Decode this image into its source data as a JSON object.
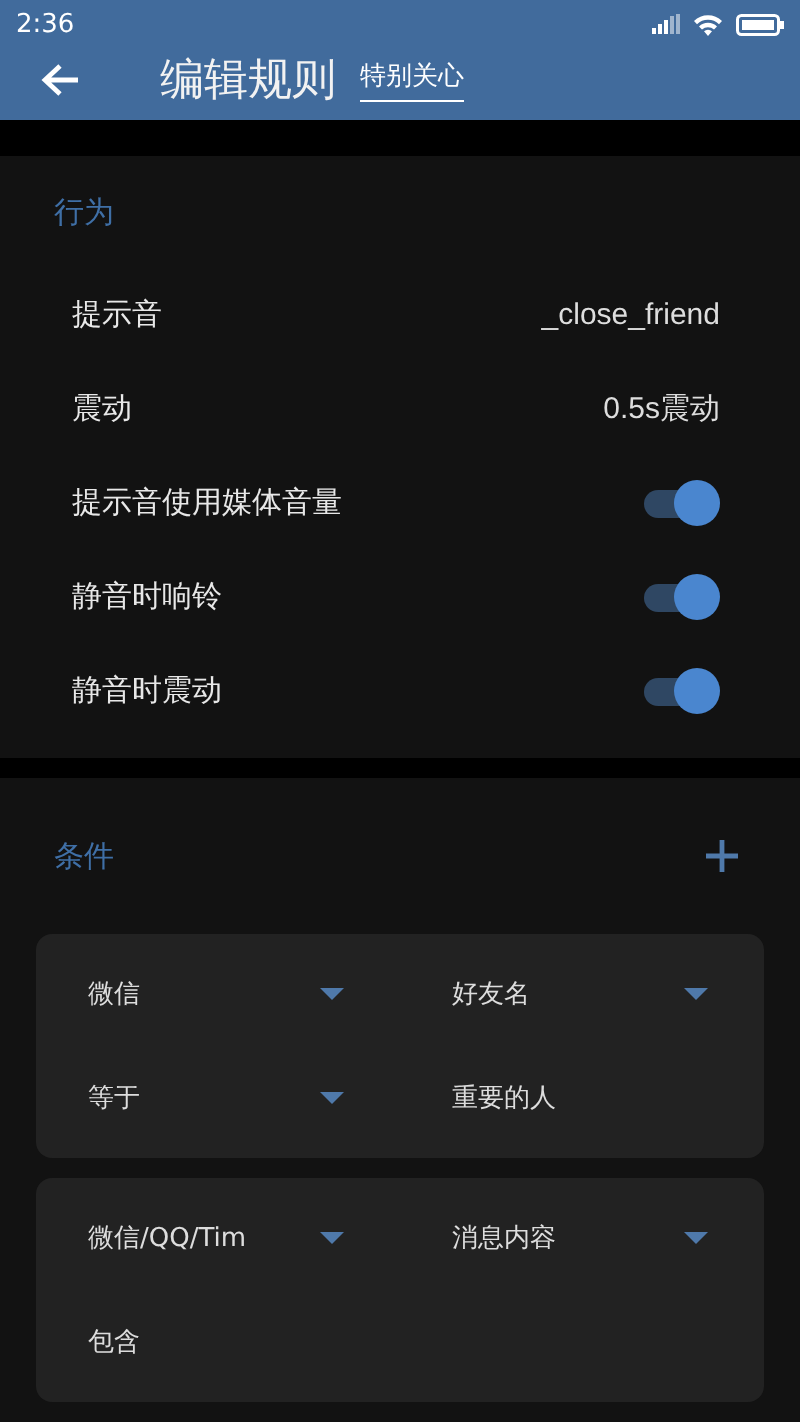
{
  "status_bar": {
    "time": "2:36"
  },
  "app_bar": {
    "title": "编辑规则",
    "subtitle": "特别关心"
  },
  "behavior": {
    "title": "行为",
    "rows": [
      {
        "kind": "value",
        "label": "提示音",
        "value": "_close_friend"
      },
      {
        "kind": "value",
        "label": "震动",
        "value": "0.5s震动"
      },
      {
        "kind": "switch",
        "label": "提示音使用媒体音量",
        "on": true
      },
      {
        "kind": "switch",
        "label": "静音时响铃",
        "on": true
      },
      {
        "kind": "switch",
        "label": "静音时震动",
        "on": true
      }
    ]
  },
  "conditions": {
    "title": "条件",
    "cards": [
      {
        "fields": [
          {
            "kind": "dropdown",
            "value": "微信"
          },
          {
            "kind": "dropdown",
            "value": "好友名"
          },
          {
            "kind": "dropdown",
            "value": "等于"
          },
          {
            "kind": "text",
            "value": "重要的人"
          }
        ]
      },
      {
        "fields": [
          {
            "kind": "dropdown",
            "value": "微信/QQ/Tim"
          },
          {
            "kind": "dropdown",
            "value": "消息内容"
          },
          {
            "kind": "text",
            "value": "包含"
          }
        ]
      }
    ]
  }
}
